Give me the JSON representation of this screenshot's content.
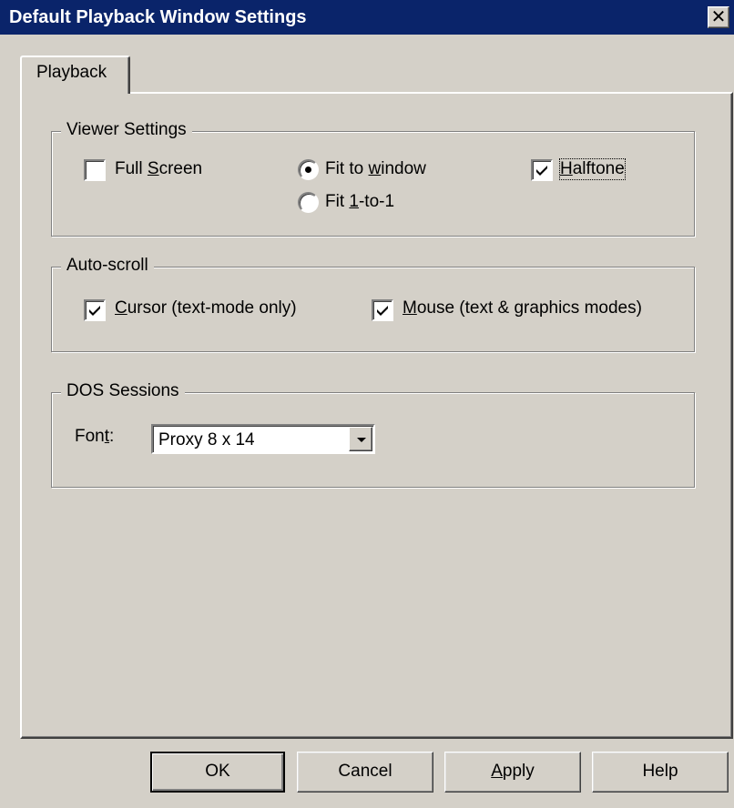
{
  "window": {
    "title": "Default Playback Window Settings",
    "close_glyph": "✕"
  },
  "tabs": [
    {
      "label": "Playback",
      "selected": true
    }
  ],
  "viewer_settings": {
    "title": "Viewer Settings",
    "full_screen": {
      "label_pre": "Full ",
      "accel": "S",
      "label_post": "creen",
      "checked": false
    },
    "fit_to_window": {
      "label_pre": "Fit to ",
      "accel": "w",
      "label_post": "indow",
      "selected": true
    },
    "fit_1_to_1": {
      "label_pre": "Fit ",
      "accel": "1",
      "label_post": "-to-1",
      "selected": false
    },
    "halftone": {
      "label_pre": "",
      "accel": "H",
      "label_post": "alftone",
      "checked": true,
      "focused": true
    }
  },
  "auto_scroll": {
    "title": "Auto-scroll",
    "cursor": {
      "label_pre": "",
      "accel": "C",
      "label_post": "ursor (text-mode only)",
      "checked": true
    },
    "mouse": {
      "label_pre": "",
      "accel": "M",
      "label_post": "ouse (text & graphics modes)",
      "checked": true
    }
  },
  "dos_sessions": {
    "title": "DOS Sessions",
    "font_label_pre": "Fon",
    "font_label_accel": "t",
    "font_label_post": ":",
    "font_value": "Proxy 8 x 14"
  },
  "buttons": {
    "ok": "OK",
    "cancel": "Cancel",
    "apply_accel": "A",
    "apply_rest": "pply",
    "help": "Help"
  },
  "icons": {
    "close": "close-icon",
    "checkmark": "checkmark-icon",
    "dropdown": "chevron-down-icon"
  }
}
